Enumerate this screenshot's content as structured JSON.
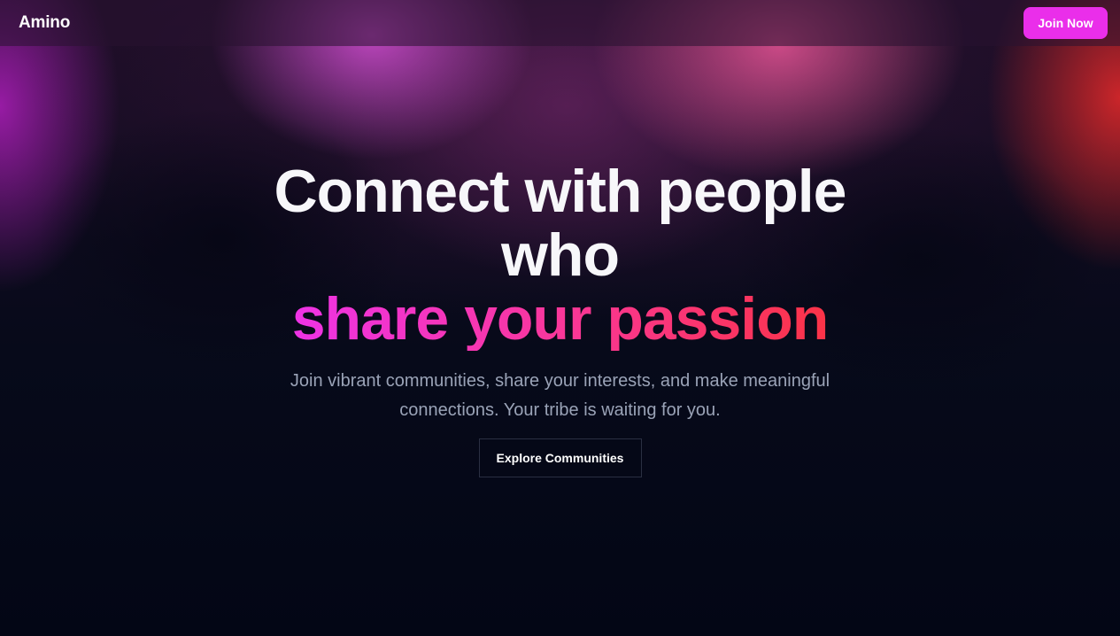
{
  "header": {
    "logo": "Amino",
    "cta_label": "Join Now"
  },
  "hero": {
    "headline_line1": "Connect with people",
    "headline_line2": "who",
    "headline_accent": "share your passion",
    "subtitle": "Join vibrant communities, share your interests, and make meaningful connections. Your tribe is waiting for you.",
    "explore_label": "Explore Communities"
  },
  "colors": {
    "brand": "#ea2eea",
    "accent_gradient_start": "#ee33e6",
    "accent_gradient_end": "#fb3347",
    "background": "#030615",
    "subtitle": "#9aa3b7"
  }
}
